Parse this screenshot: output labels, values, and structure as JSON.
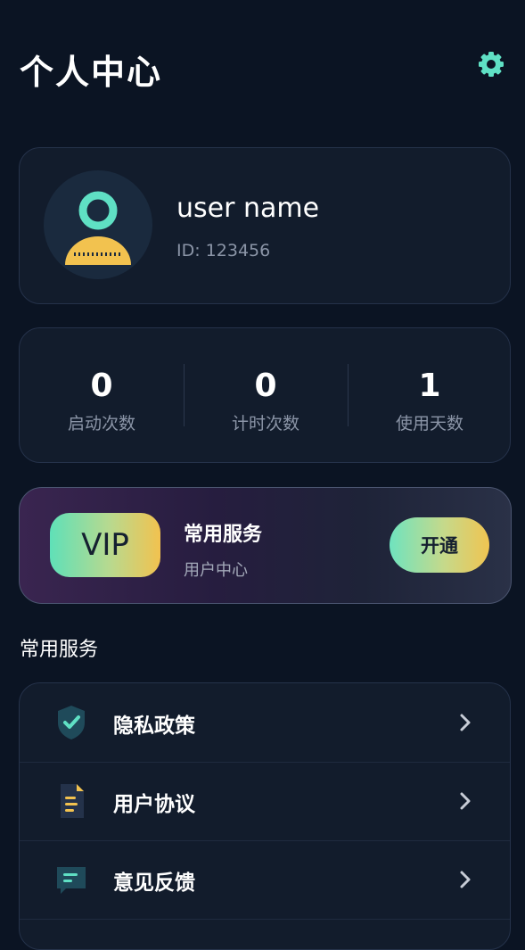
{
  "header": {
    "title": "个人中心",
    "settings_icon": "gear-icon"
  },
  "profile": {
    "username": "user name",
    "id_text": "ID: 123456",
    "avatar_icon": "user-avatar-icon"
  },
  "stats": [
    {
      "value": "0",
      "label": "启动次数"
    },
    {
      "value": "0",
      "label": "计时次数"
    },
    {
      "value": "1",
      "label": "使用天数"
    }
  ],
  "vip": {
    "badge": "VIP",
    "title": "常用服务",
    "subtitle": "用户中心",
    "button": "开通"
  },
  "section": {
    "title": "常用服务"
  },
  "menu": [
    {
      "label": "隐私政策",
      "icon": "shield-check-icon"
    },
    {
      "label": "用户协议",
      "icon": "document-icon"
    },
    {
      "label": "意见反馈",
      "icon": "chat-bubble-icon"
    }
  ],
  "colors": {
    "background": "#0b1423",
    "card": "#121c2c",
    "accent_teal": "#5fe0b8",
    "accent_gold": "#f2c24f"
  }
}
